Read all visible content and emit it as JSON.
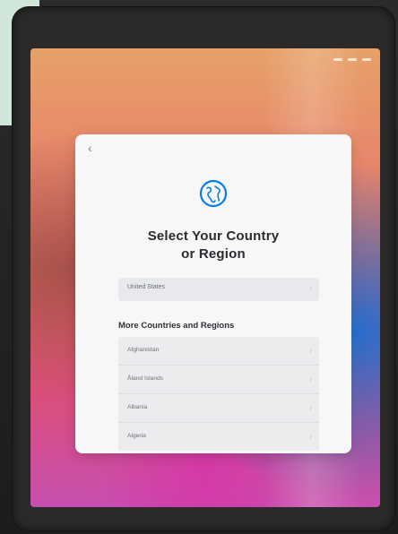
{
  "colors": {
    "sheet_background": "#f7f7f8",
    "accent": "#0a7bea",
    "row_background": "#e8e9ec"
  },
  "setup": {
    "back_icon": "chevron-left",
    "globe_icon": "globe",
    "title_line1": "Select Your Country",
    "title_line2": "or Region",
    "selected_country": "United States",
    "section_title": "More Countries and Regions",
    "countries": [
      "Afghanistan",
      "Åland Islands",
      "Albania",
      "Algeria"
    ]
  }
}
